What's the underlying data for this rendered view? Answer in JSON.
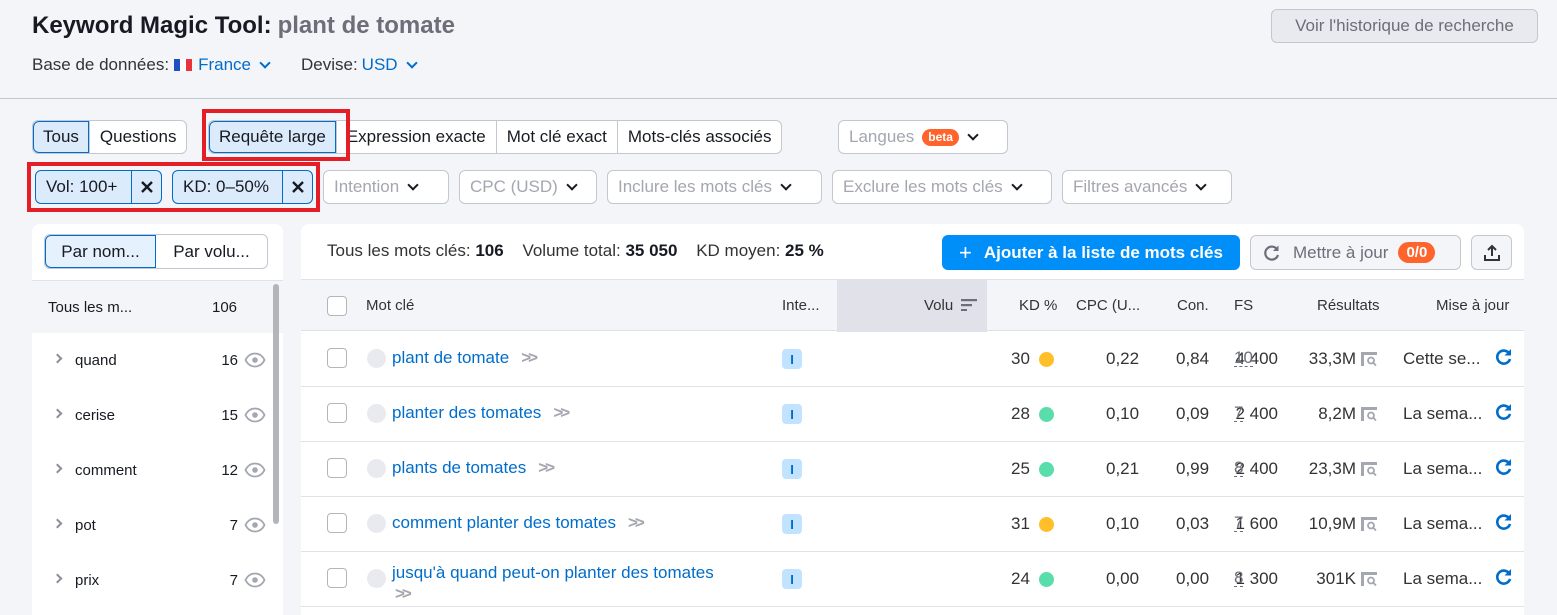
{
  "header": {
    "title": "Keyword Magic Tool:",
    "query": "plant de tomate",
    "database_label": "Base de données:",
    "database_value": "France",
    "currency_label": "Devise:",
    "currency_value": "USD",
    "history_button": "Voir l'historique de recherche"
  },
  "match_tabs": {
    "group1": [
      {
        "label": "Tous",
        "active": true
      },
      {
        "label": "Questions",
        "active": false
      }
    ],
    "group2": [
      {
        "label": "Requête large",
        "active": true
      },
      {
        "label": "Expression exacte",
        "active": false
      },
      {
        "label": "Mot clé exact",
        "active": false
      },
      {
        "label": "Mots-clés associés",
        "active": false
      }
    ],
    "languages": {
      "label": "Langues",
      "badge": "beta"
    }
  },
  "filters": {
    "applied": [
      {
        "label": "Vol: 100+"
      },
      {
        "label": "KD: 0–50%"
      }
    ],
    "dropdowns": [
      "Intention",
      "CPC (USD)",
      "Inclure les mots clés",
      "Exclure les mots clés",
      "Filtres avancés"
    ],
    "remove_glyph": "✕"
  },
  "groups_panel": {
    "toggle": [
      "Par nom...",
      "Par volu..."
    ],
    "all": {
      "label": "Tous les m...",
      "count": "106"
    },
    "items": [
      {
        "label": "quand",
        "count": "16"
      },
      {
        "label": "cerise",
        "count": "15"
      },
      {
        "label": "comment",
        "count": "12"
      },
      {
        "label": "pot",
        "count": "7"
      },
      {
        "label": "prix",
        "count": "7"
      }
    ]
  },
  "summary": {
    "all_label": "Tous les mots clés:",
    "all_value": "106",
    "volume_label": "Volume total:",
    "volume_value": "35 050",
    "kd_label": "KD moyen:",
    "kd_value": "25 %"
  },
  "toolbar": {
    "add_label": "Ajouter à la liste de mots clés",
    "add_icon": "+",
    "update_label": "Mettre à jour",
    "update_count": "0/0"
  },
  "table": {
    "columns": {
      "keyword": "Mot clé",
      "intent": "Inte...",
      "volume": "Volu",
      "kd": "KD %",
      "cpc": "CPC (U...",
      "com": "Con.",
      "fs": "FS",
      "results": "Résultats",
      "updated": "Mise à jour"
    },
    "rows": [
      {
        "keyword": "plant de tomate",
        "intent": "I",
        "volume": "4 400",
        "kd": "30",
        "kd_color": "#ffbf29",
        "cpc": "0,22",
        "com": "0,84",
        "fs": "10",
        "results": "33,3M",
        "updated": "Cette se..."
      },
      {
        "keyword": "planter des tomates",
        "intent": "I",
        "volume": "2 400",
        "kd": "28",
        "kd_color": "#59ddaa",
        "cpc": "0,10",
        "com": "0,09",
        "fs": "7",
        "results": "8,2M",
        "updated": "La sema..."
      },
      {
        "keyword": "plants de tomates",
        "intent": "I",
        "volume": "2 400",
        "kd": "25",
        "kd_color": "#59ddaa",
        "cpc": "0,21",
        "com": "0,99",
        "fs": "8",
        "results": "23,3M",
        "updated": "La sema..."
      },
      {
        "keyword": "comment planter des tomates",
        "intent": "I",
        "volume": "1 600",
        "kd": "31",
        "kd_color": "#ffbf29",
        "cpc": "0,10",
        "com": "0,03",
        "fs": "7",
        "results": "10,9M",
        "updated": "La sema..."
      },
      {
        "keyword": "jusqu'à quand peut-on planter des tomates",
        "intent": "I",
        "volume": "1 300",
        "kd": "24",
        "kd_color": "#59ddaa",
        "cpc": "0,00",
        "com": "0,00",
        "fs": "8",
        "results": "301K",
        "updated": "La sema..."
      }
    ]
  },
  "colors": {
    "accent": "#006dca",
    "primary_button": "#008ff8",
    "badge": "#ff642d",
    "highlight_box": "#e41e26",
    "kd_easy": "#59ddaa",
    "kd_possible": "#ffbf29"
  }
}
